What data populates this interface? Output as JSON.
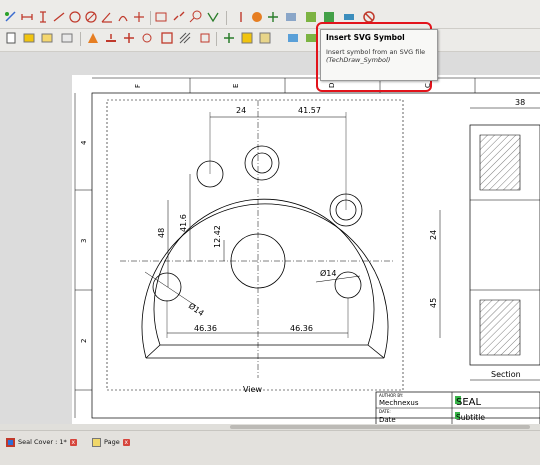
{
  "tooltip": {
    "title": "Insert SVG Symbol",
    "description": "Insert symbol from an SVG file",
    "command": "(TechDraw_Symbol)"
  },
  "drawing": {
    "zone_letters": [
      "F",
      "E",
      "D",
      "C"
    ],
    "zone_numbers": [
      "4",
      "3",
      "2"
    ],
    "dims": {
      "d1": "24",
      "d2": "41.57",
      "d3": "38",
      "d4": "48",
      "d5": "41.6",
      "d6": "12.42",
      "d7": "24",
      "d8": "Ø14",
      "d9": "Ø14",
      "d10": "45",
      "d11": "46.36",
      "d12": "46.36"
    },
    "view_label": "View",
    "section_label": "Section",
    "title_block": {
      "author_caption": "AUTHOR BY:",
      "author": "Mechnexus",
      "date_caption": "DATE:",
      "date": "Date",
      "title": "SEAL",
      "subtitle": "Subtitle"
    }
  },
  "tabs": [
    {
      "label": "Seal Cover : 1*"
    },
    {
      "label": "Page"
    }
  ],
  "colors": {
    "highlight": "#e2131b",
    "drawing_line": "#000000",
    "paper": "#ffffff"
  }
}
